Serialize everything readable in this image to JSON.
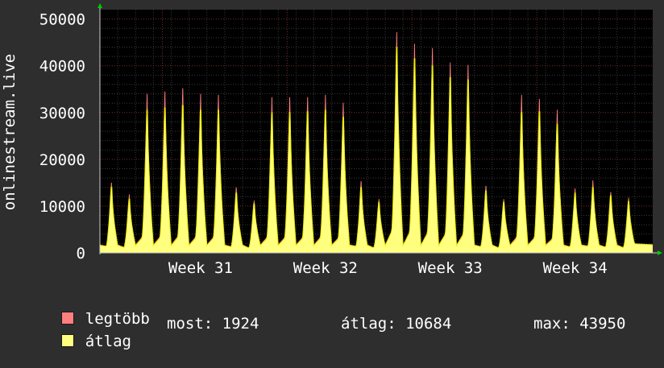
{
  "chart_data": {
    "type": "area",
    "ylabel": "onlinestream.live",
    "ylim": [
      0,
      52000
    ],
    "y_ticks": [
      0,
      10000,
      20000,
      30000,
      40000,
      50000
    ],
    "y_tick_labels": [
      "0",
      "10000",
      "20000",
      "30000",
      "40000",
      "50000"
    ],
    "x_tick_labels": [
      "Week 31",
      "Week 32",
      "Week 33",
      "Week 34"
    ],
    "grid": true,
    "days": 31,
    "series": [
      {
        "name": "legtöbb",
        "color": "#ff7f7f",
        "daily_peak": [
          15000,
          12500,
          34000,
          34500,
          35200,
          34000,
          33800,
          14000,
          11200,
          33300,
          33300,
          33300,
          33800,
          32100,
          15300,
          11500,
          47200,
          44700,
          43800,
          40700,
          40200,
          14300,
          11500,
          33800,
          32900,
          30600,
          13800,
          15500,
          13000,
          11800,
          2000
        ]
      },
      {
        "name": "átlag",
        "color": "#ffff7f",
        "daily_peak": [
          14000,
          11500,
          30500,
          31000,
          31500,
          30500,
          30500,
          12800,
          10500,
          30000,
          30000,
          30200,
          30500,
          29000,
          14000,
          10800,
          43950,
          41500,
          40000,
          37500,
          37000,
          13200,
          10800,
          30000,
          30200,
          27500,
          12800,
          14000,
          12200,
          11000,
          1924
        ]
      }
    ]
  },
  "legend": {
    "max_label": "legtöbb",
    "avg_label": "átlag"
  },
  "stats": {
    "current": "most: 1924",
    "average": "átlag: 10684",
    "maximum": "max: 43950"
  }
}
